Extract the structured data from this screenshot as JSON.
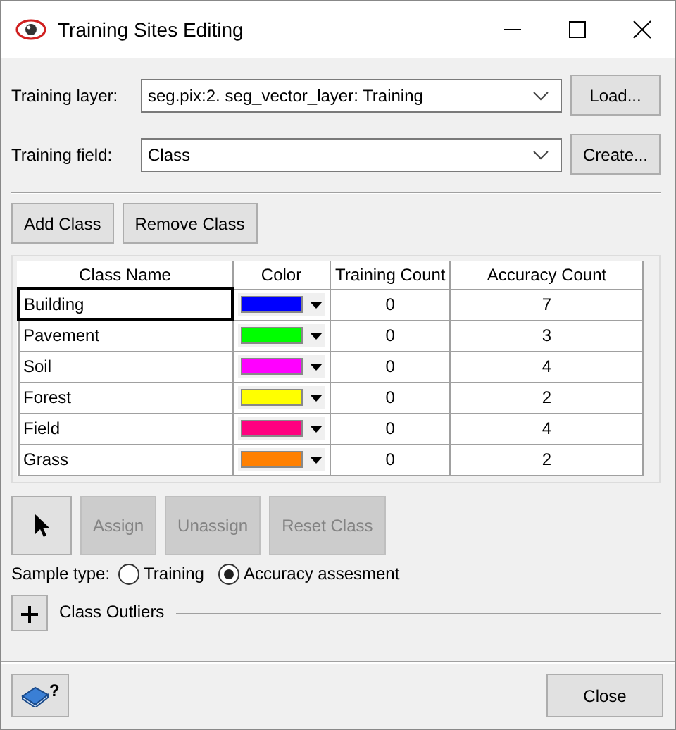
{
  "window": {
    "title": "Training Sites Editing"
  },
  "fields": [
    {
      "label": "Training layer:",
      "value": "seg.pix:2. seg_vector_layer: Training",
      "button": "Load..."
    },
    {
      "label": "Training field:",
      "value": "Class",
      "button": "Create..."
    }
  ],
  "class_buttons": [
    {
      "label": "Add Class",
      "disabled": false
    },
    {
      "label": "Remove Class",
      "disabled": false
    }
  ],
  "table": {
    "columns": [
      "Class Name",
      "Color",
      "Training Count",
      "Accuracy Count"
    ],
    "rows": [
      {
        "name": "Building",
        "color": "#0000ff",
        "training": "0",
        "accuracy": "7",
        "focused": true
      },
      {
        "name": "Pavement",
        "color": "#00ff00",
        "training": "0",
        "accuracy": "3",
        "focused": false
      },
      {
        "name": "Soil",
        "color": "#ff00ff",
        "training": "0",
        "accuracy": "4",
        "focused": false
      },
      {
        "name": "Forest",
        "color": "#ffff00",
        "training": "0",
        "accuracy": "2",
        "focused": false
      },
      {
        "name": "Field",
        "color": "#ff0080",
        "training": "0",
        "accuracy": "4",
        "focused": false
      },
      {
        "name": "Grass",
        "color": "#ff8000",
        "training": "0",
        "accuracy": "2",
        "focused": false
      }
    ]
  },
  "tools": [
    {
      "kind": "pointer",
      "disabled": false
    },
    {
      "kind": "text",
      "label": "Assign",
      "disabled": true
    },
    {
      "kind": "text",
      "label": "Unassign",
      "disabled": true
    },
    {
      "kind": "text",
      "label": "Reset Class",
      "disabled": true
    }
  ],
  "sample_type": {
    "label": "Sample type:",
    "options": [
      {
        "label": "Training",
        "selected": false
      },
      {
        "label": "Accuracy assesment",
        "selected": true
      }
    ]
  },
  "outliers": {
    "label": "Class Outliers",
    "expanded": false
  },
  "footer": {
    "help_mark": "?",
    "close": "Close"
  }
}
